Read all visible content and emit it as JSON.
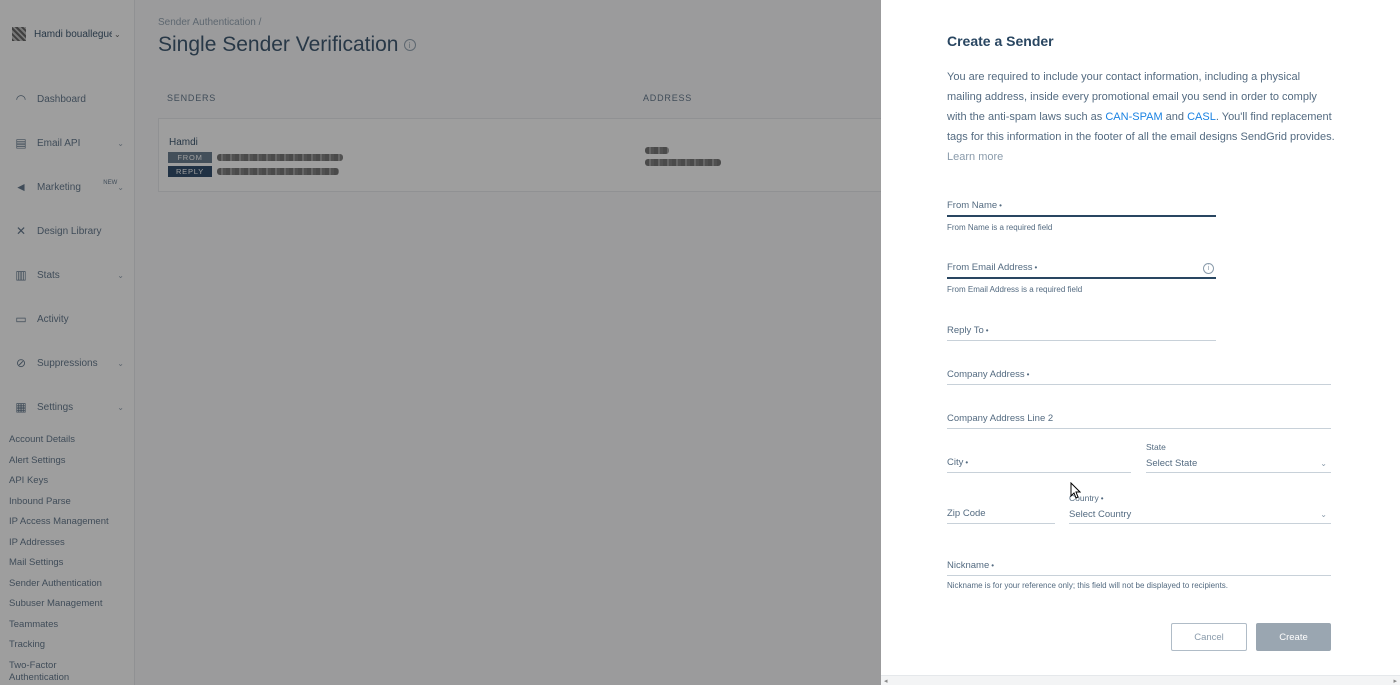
{
  "sidebar": {
    "account_name": "Hamdi bouallegue",
    "items": [
      {
        "label": "Dashboard",
        "icon": "dashboard-icon",
        "glyph": "◠",
        "has_children": false
      },
      {
        "label": "Email API",
        "icon": "email-api-icon",
        "glyph": "▤",
        "has_children": true
      },
      {
        "label": "Marketing",
        "icon": "marketing-icon",
        "glyph": "◄",
        "has_children": true,
        "badge": "NEW"
      },
      {
        "label": "Design Library",
        "icon": "design-library-icon",
        "glyph": "✕",
        "has_children": false
      },
      {
        "label": "Stats",
        "icon": "stats-icon",
        "glyph": "▥",
        "has_children": true
      },
      {
        "label": "Activity",
        "icon": "activity-icon",
        "glyph": "▭",
        "has_children": false
      },
      {
        "label": "Suppressions",
        "icon": "suppressions-icon",
        "glyph": "⊘",
        "has_children": true
      },
      {
        "label": "Settings",
        "icon": "settings-icon",
        "glyph": "▦",
        "has_children": true
      }
    ],
    "settings_sub": [
      "Account Details",
      "Alert Settings",
      "API Keys",
      "Inbound Parse",
      "IP Access Management",
      "IP Addresses",
      "Mail Settings",
      "Sender Authentication",
      "Subuser Management",
      "Teammates",
      "Tracking",
      "Two-Factor Authentication"
    ]
  },
  "main": {
    "breadcrumb": "Sender Authentication  /",
    "title": "Single Sender Verification",
    "columns": {
      "senders": "SENDERS",
      "address": "ADDRESS"
    },
    "sender": {
      "name": "Hamdi",
      "from_tag": "FROM",
      "reply_tag": "REPLY"
    }
  },
  "panel": {
    "title": "Create a Sender",
    "desc_1": "You are required to include your contact information, including a physical mailing address, inside every promotional email you send in order to comply with the anti-spam laws such as ",
    "can_spam": "CAN-SPAM",
    "and": " and ",
    "casl": "CASL",
    "desc_2": ". You'll find replacement tags for this information in the footer of all the email designs SendGrid provides. ",
    "learn_more": "Learn more",
    "req_mark": "•",
    "from_name": {
      "label": "From Name",
      "error": "From Name is a required field"
    },
    "from_email": {
      "label": "From Email Address",
      "error": "From Email Address is a required field"
    },
    "reply_to": {
      "label": "Reply To"
    },
    "company_address": {
      "label": "Company Address"
    },
    "company_address_2": {
      "label": "Company Address Line 2"
    },
    "city": {
      "label": "City"
    },
    "state": {
      "label": "State",
      "value": "Select State"
    },
    "zip": {
      "label": "Zip Code"
    },
    "country": {
      "label": "Country",
      "value": "Select Country"
    },
    "nickname": {
      "label": "Nickname",
      "help": "Nickname is for your reference only; this field will not be displayed to recipients."
    },
    "cancel": "Cancel",
    "create": "Create"
  }
}
